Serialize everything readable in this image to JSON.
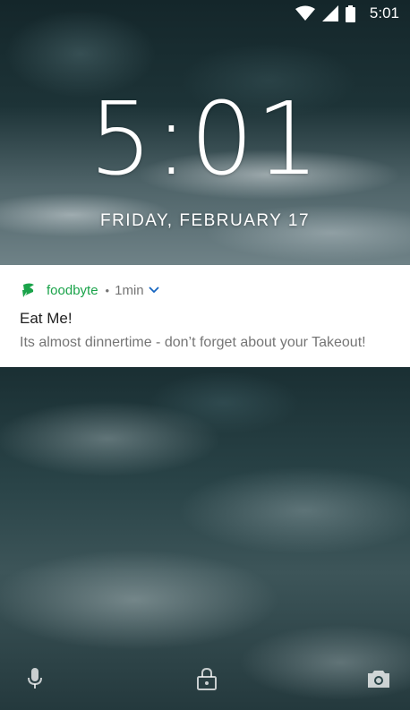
{
  "status_bar": {
    "time": "5:01",
    "icons": [
      "wifi-icon",
      "cell-signal-icon",
      "battery-icon"
    ]
  },
  "lock_screen": {
    "clock": "5:01",
    "date": "FRIDAY, FEBRUARY 17"
  },
  "notification": {
    "app_icon": "foodbyte-logo-icon",
    "app_name": "foodbyte",
    "separator": "•",
    "time": "1min",
    "expand_icon": "chevron-down-icon",
    "title": "Eat Me!",
    "body": "Its almost dinnertime - don’t forget about your Takeout!"
  },
  "shortcuts": {
    "left": "microphone-icon",
    "center": "lock-icon",
    "right": "camera-icon"
  },
  "colors": {
    "app_accent": "#1aa34a",
    "secondary_text": "#757575",
    "primary_text": "#212121",
    "card_background": "#ffffff"
  }
}
